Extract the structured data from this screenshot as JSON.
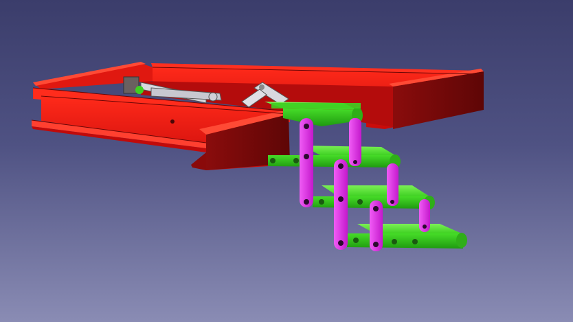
{
  "viewport": {
    "background_top": "#3b3d6b",
    "background_bottom": "#8a8cb4"
  },
  "model": {
    "frame_color": "#e01010",
    "frame_dark": "#7a0a0a",
    "step_color": "#44e02a",
    "step_dark": "#1f8a12",
    "link_color": "#e020e8",
    "link_dark": "#8a128f",
    "mechanism_color": "#d8d8de",
    "step_count": 4
  }
}
